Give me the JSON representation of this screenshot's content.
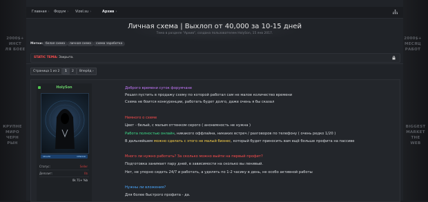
{
  "side": {
    "left_top": [
      "2000$+",
      "ИНСТ",
      "ЛЯ БОЕЕ"
    ],
    "left_bottom": [
      "КРУПНЕ",
      "МИРО",
      "ЧЕРН",
      "РЫН"
    ],
    "right_top": [
      "2000$+",
      "МЕСЯЦ",
      "РАБОТ"
    ],
    "right_bottom": [
      "BIGGEST",
      "MARKET",
      "THE",
      "WEB"
    ]
  },
  "nav": {
    "crumbs": [
      "Главная",
      "Форум",
      "Vizel.su",
      "Архив"
    ]
  },
  "header": {
    "title": "Личная схема | Выхлоп от 40,000 за 10-15 дней",
    "subtitle": "Тема в разделе \"Архив\", создана пользователем HolySon, 15 янв 2017."
  },
  "tags": {
    "label": "Метки:",
    "items": [
      "белая схема",
      "личная схема",
      "схема заработка"
    ]
  },
  "notice": {
    "prefix": "STATIC ТЕМА:",
    "text": "Закрыта."
  },
  "pager": {
    "label": "Страница 1 из 2",
    "pages": [
      "1",
      "2"
    ],
    "next": "Вперёд"
  },
  "post": {
    "username": "HolySon",
    "rank": "SELLER",
    "rank_right": "VENDOR",
    "stats": [
      {
        "label": "Статус:",
        "value": "Seller"
      },
      {
        "label": "Депозит:",
        "value": "0$"
      },
      {
        "label": "",
        "value": "0k 71+ %b"
      }
    ],
    "lines": [
      {
        "text": "Доброго времени суток форумчане",
        "color": "purple"
      },
      {
        "text": "Решил пустить в продажу схему по которой работал сам не малое количество времени"
      },
      {
        "text": "Схема не боится конкуренции, работать будет долго, даже очень я бы сказал"
      },
      {
        "text": "Немного о схеме",
        "color": "red"
      },
      {
        "text": "Цвет - белый, с малым оттенком серого ( анонимность не нужна )"
      },
      {
        "segments": [
          {
            "text": "Работа полностью онлайн",
            "color": "green"
          },
          {
            "text": ", никакого оффлайна, никаких встреч / разговоров по телефону ( очень редко 1/20 )"
          }
        ]
      },
      {
        "segments": [
          {
            "text": "В дальнейшем "
          },
          {
            "text": "можно сделать с этого не малый бизнес",
            "color": "yellow"
          },
          {
            "text": ", который будет приносить вам ещё больше профита на пассиве"
          }
        ]
      },
      {
        "text": "Много ли нужно работать? За сколько можно выйти на первый профит?",
        "color": "red"
      },
      {
        "text": "Подготовка занимает пару дней, в зависимости на сколько вы ленивый."
      },
      {
        "text": "Нет, не упорно сидеть 24/7 и работать, а уделять по 1-2 часику в день, не особо активной работы"
      },
      {
        "text": "Нужны ли вложения?",
        "color": "blue"
      },
      {
        "text": "Для более быстрого профита - да."
      }
    ]
  }
}
